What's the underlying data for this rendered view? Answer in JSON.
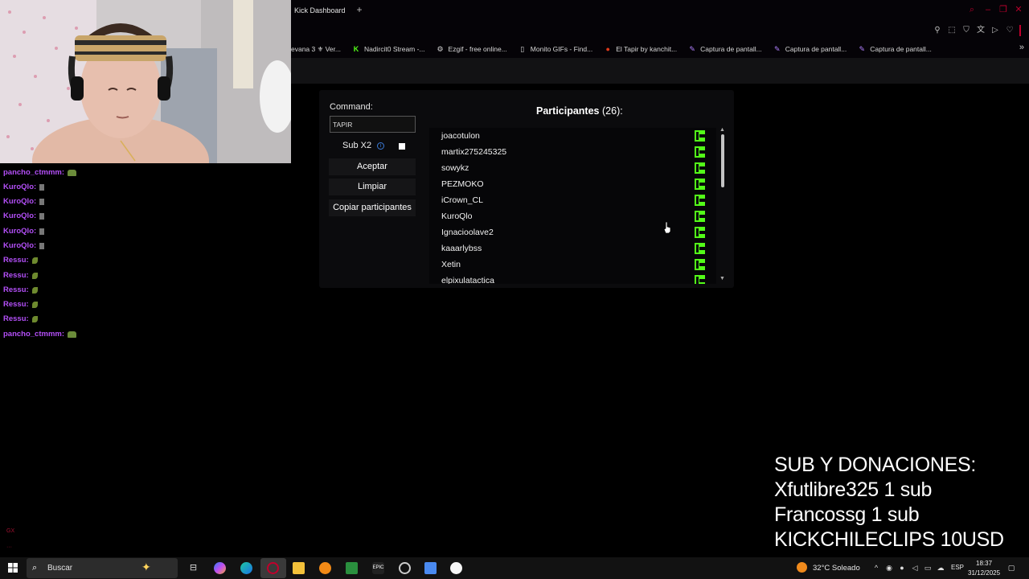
{
  "browser": {
    "active_tab": "Kick Dashboard",
    "new_tab": "+",
    "bookmarks": [
      {
        "label": "evana 3 ⚜ Ver...",
        "icon": "fleur-icon",
        "color": "#e0b030"
      },
      {
        "label": "Nadircit0 Stream -...",
        "icon": "kick-icon",
        "color": "#53fc18"
      },
      {
        "label": "Ezgif - free online...",
        "icon": "gear-icon",
        "color": "#cccccc"
      },
      {
        "label": "Monito GIFs - Find...",
        "icon": "document-icon",
        "color": "#cccccc"
      },
      {
        "label": "El Tapir by kanchit...",
        "icon": "red-circle-icon",
        "color": "#e03a1a"
      },
      {
        "label": "Captura de pantall...",
        "icon": "quill-icon",
        "color": "#b080ff"
      },
      {
        "label": "Captura de pantall...",
        "icon": "quill-icon",
        "color": "#b080ff"
      },
      {
        "label": "Captura de pantall...",
        "icon": "quill-icon",
        "color": "#b080ff"
      }
    ]
  },
  "dashboard": {
    "command_label": "Command:",
    "command_value": "TAPIR",
    "sub_label": "Sub X2",
    "sub_checked": true,
    "buttons": {
      "accept": "Aceptar",
      "clear": "Limpiar",
      "copy": "Copiar participantes"
    },
    "participants_title": "Participantes",
    "participants_count": "(26):",
    "participants": [
      "joacotulon",
      "martix275245325",
      "sowykz",
      "PEZMOKO",
      "iCrown_CL",
      "KuroQlo",
      "Ignacioolave2",
      "kaaarlybss",
      "Xetin",
      "elpixulatactica"
    ],
    "accent_color": "#53fc18"
  },
  "chat": [
    {
      "user": "pancho_ctmmm",
      "emote": "green-cap-emote"
    },
    {
      "user": "KuroQlo",
      "emote": "figure-emote"
    },
    {
      "user": "KuroQlo",
      "emote": "figure-emote"
    },
    {
      "user": "KuroQlo",
      "emote": "figure-emote"
    },
    {
      "user": "KuroQlo",
      "emote": "figure-emote"
    },
    {
      "user": "KuroQlo",
      "emote": "figure-emote"
    },
    {
      "user": "Ressu",
      "emote": "leaf-emote"
    },
    {
      "user": "Ressu",
      "emote": "leaf-emote"
    },
    {
      "user": "Ressu",
      "emote": "leaf-emote"
    },
    {
      "user": "Ressu",
      "emote": "leaf-emote"
    },
    {
      "user": "Ressu",
      "emote": "leaf-emote"
    },
    {
      "user": "pancho_ctmmm",
      "emote": "green-cap-emote"
    }
  ],
  "donations": {
    "line1": "SUB Y DONACIONES:",
    "line2": "Xfutlibre325 1 sub",
    "line3": "Francossg 1 sub",
    "line4": "KICKCHILECLIPS 10USD"
  },
  "taskbar": {
    "search_placeholder": "Buscar",
    "weather": "32°C  Soleado",
    "language": "ESP",
    "time": "18:37",
    "date": "31/12/2025"
  }
}
